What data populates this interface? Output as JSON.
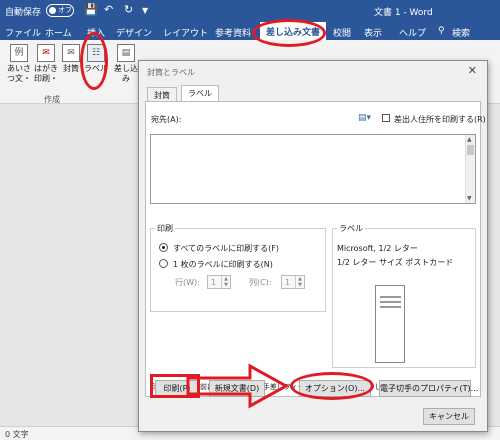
{
  "titlebar": {
    "autosave_label": "自動保存",
    "autosave_state": "オフ",
    "doc_title": "文書 1 - Word"
  },
  "ribbon_tabs": [
    "ファイル",
    "ホーム",
    "挿入",
    "デザイン",
    "レイアウト",
    "参考資料",
    "差し込み文書",
    "校閲",
    "表示",
    "ヘルプ",
    "検索"
  ],
  "ribbon": {
    "buttons": [
      "あいさつ文・",
      "はがき印刷・",
      "封筒",
      "ラベル",
      "差し込み"
    ],
    "button_sub": [
      "例",
      "",
      "",
      "",
      ""
    ],
    "group_label": "作成"
  },
  "dialog": {
    "title": "封筒とラベル",
    "tabs": [
      "封筒",
      "ラベル"
    ],
    "address_label": "宛先(A):",
    "print_return_label": "差出人住所を印刷する(R)",
    "print_group": {
      "title": "印刷",
      "option_all": "すべてのラベルに印刷する(F)",
      "option_single": "1 枚のラベルに印刷する(N)",
      "row_label": "行(W):",
      "row_value": "1",
      "col_label": "列(C):",
      "col_value": "1"
    },
    "label_group": {
      "title": "ラベル",
      "line1": "Microsoft, 1/2 レター",
      "line2": "1/2 レター サイズ ポストカード"
    },
    "hint": "印刷を開始する前に、プリンターの手差しフィーダーにラベルをセットしてください。",
    "buttons": {
      "print": "印刷(P)",
      "new_doc": "新規文書(D)",
      "options": "オプション(O)...",
      "epostage": "電子切手のプロパティ(T)...",
      "cancel": "キャンセル"
    }
  },
  "statusbar": {
    "word_count": "0 文字"
  },
  "colors": {
    "word_blue": "#2b579a",
    "annotation_red": "#e01b24"
  }
}
